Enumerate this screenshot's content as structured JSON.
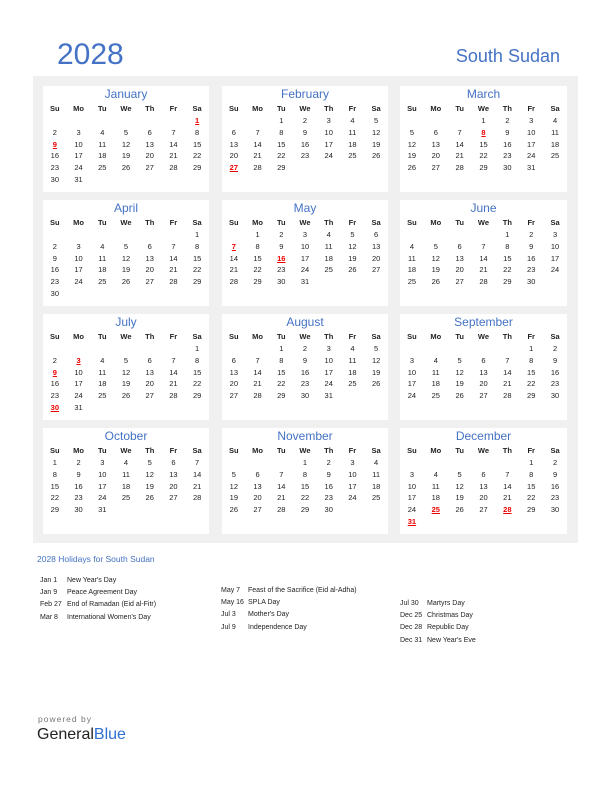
{
  "header": {
    "year": "2028",
    "country": "South Sudan"
  },
  "weekdays": [
    "Su",
    "Mo",
    "Tu",
    "We",
    "Th",
    "Fr",
    "Sa"
  ],
  "months": [
    {
      "name": "January",
      "offset": 6,
      "days": 31,
      "holidays": [
        1,
        9
      ]
    },
    {
      "name": "February",
      "offset": 2,
      "days": 29,
      "holidays": [
        27
      ]
    },
    {
      "name": "March",
      "offset": 3,
      "days": 31,
      "holidays": [
        8
      ]
    },
    {
      "name": "April",
      "offset": 6,
      "days": 30,
      "holidays": []
    },
    {
      "name": "May",
      "offset": 1,
      "days": 31,
      "holidays": [
        7,
        16
      ]
    },
    {
      "name": "June",
      "offset": 4,
      "days": 30,
      "holidays": []
    },
    {
      "name": "July",
      "offset": 6,
      "days": 31,
      "holidays": [
        3,
        9,
        30
      ]
    },
    {
      "name": "August",
      "offset": 2,
      "days": 31,
      "holidays": []
    },
    {
      "name": "September",
      "offset": 5,
      "days": 30,
      "holidays": []
    },
    {
      "name": "October",
      "offset": 0,
      "days": 31,
      "holidays": []
    },
    {
      "name": "November",
      "offset": 3,
      "days": 30,
      "holidays": []
    },
    {
      "name": "December",
      "offset": 5,
      "days": 31,
      "holidays": [
        25,
        28,
        31
      ]
    }
  ],
  "holidays_title": "2028 Holidays for South Sudan",
  "holiday_columns": [
    [
      {
        "date": "Jan 1",
        "name": "New Year's Day"
      },
      {
        "date": "Jan 9",
        "name": "Peace Agreement Day"
      },
      {
        "date": "Feb 27",
        "name": "End of Ramadan (Eid al-Fitr)"
      },
      {
        "date": "Mar 8",
        "name": "International Women's Day"
      }
    ],
    [
      {
        "date": "May 7",
        "name": "Feast of the Sacrifice (Eid al-Adha)"
      },
      {
        "date": "May 16",
        "name": "SPLA Day"
      },
      {
        "date": "Jul 3",
        "name": "Mother's Day"
      },
      {
        "date": "Jul 9",
        "name": "Independence Day"
      }
    ],
    [
      {
        "date": "Jul 30",
        "name": "Martyrs Day"
      },
      {
        "date": "Dec 25",
        "name": "Christmas Day"
      },
      {
        "date": "Dec 28",
        "name": "Republic Day"
      },
      {
        "date": "Dec 31",
        "name": "New Year's Eve"
      }
    ]
  ],
  "footer": {
    "powered": "powered by",
    "brand_general": "General",
    "brand_blue": "Blue"
  }
}
